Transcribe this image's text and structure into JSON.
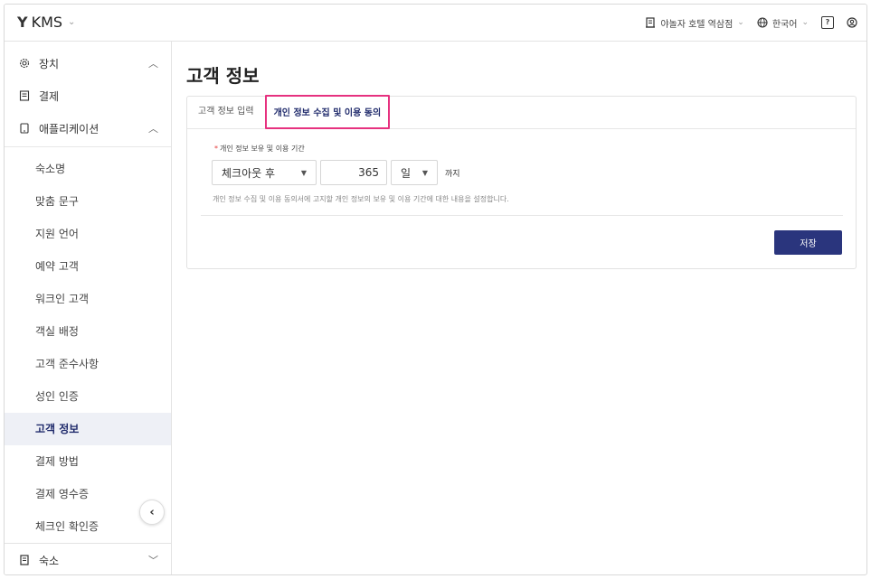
{
  "app": {
    "name": "KMS"
  },
  "topbar": {
    "property": "야놀자 호텔 역삼점",
    "language": "한국어",
    "help_icon": "help-icon",
    "account_icon": "account-icon"
  },
  "sidebar": {
    "groups": [
      {
        "label": "장치",
        "icon": "gear-icon"
      },
      {
        "label": "결제",
        "icon": "receipt-icon"
      },
      {
        "label": "애플리케이션",
        "icon": "tablet-icon"
      }
    ],
    "sub_items": [
      "숙소명",
      "맞춤 문구",
      "지원 언어",
      "예약 고객",
      "워크인 고객",
      "객실 배정",
      "고객 준수사항",
      "성인 인증",
      "고객 정보",
      "결제 방법",
      "결제 영수증",
      "체크인 확인증"
    ],
    "active_item": "고객 정보",
    "bottom": {
      "label": "숙소",
      "icon": "building-icon"
    }
  },
  "main": {
    "title": "고객 정보",
    "tabs": [
      "고객 정보 입력",
      "개인 정보 수집 및 이용 동의"
    ],
    "active_tab": "개인 정보 수집 및 이용 동의",
    "field_label": "개인 정보 보유 및 이용 기간",
    "basis_select": "체크아웃 후",
    "period_value": "365",
    "unit_select": "일",
    "suffix": "까지",
    "helper": "개인 정보 수집 및 이용 동의서에 고지할 개인 정보의 보유 및 이용 기간에 대한 내용을 설정합니다.",
    "save_label": "저장"
  },
  "colors": {
    "accent": "#2a357d",
    "highlight": "#e6317f",
    "active_bg": "#eef0f6"
  }
}
